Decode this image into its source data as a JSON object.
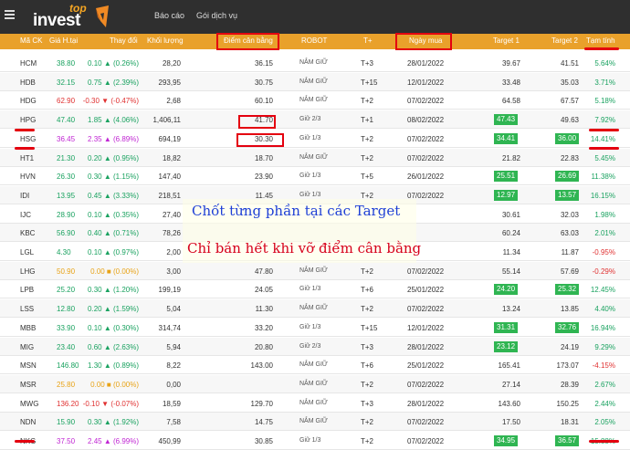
{
  "brand": {
    "logo_top": "top",
    "logo_invest": "invest",
    "colors": {
      "header_bg": "#2f2f2f",
      "table_header_bg": "#e9a12b",
      "up": "#1aa260",
      "down": "#e03131",
      "target_bg": "#2fb552",
      "annotation": "#e4000f"
    }
  },
  "nav": {
    "item1": "Báo cáo",
    "item2": "Gói dịch vụ"
  },
  "table": {
    "headers": [
      "Mã CK",
      "Giá H.tại",
      "Thay đổi",
      "Khối lượng",
      "Điểm cân bằng",
      "ROBOT",
      "T+",
      "Ngày mua",
      "Target 1",
      "Target 2",
      "Tạm tính"
    ],
    "rows": [
      {
        "code": "HCM",
        "price": "38.80",
        "chg": "0.10 ▲ (0.26%)",
        "dir": "up",
        "vol": "28,20",
        "bal": "36.15",
        "robot": "NẮM GIỮ",
        "t": "T+3",
        "date": "28/01/2022",
        "t1": "39.67",
        "t1hit": false,
        "t2": "41.51",
        "t2hit": false,
        "pct": "5.64%",
        "pdir": "up"
      },
      {
        "code": "HDB",
        "price": "32.15",
        "chg": "0.75 ▲ (2.39%)",
        "dir": "up",
        "vol": "293,95",
        "bal": "30.75",
        "robot": "NẮM GIỮ",
        "t": "T+15",
        "date": "12/01/2022",
        "t1": "33.48",
        "t1hit": false,
        "t2": "35.03",
        "t2hit": false,
        "pct": "3.71%",
        "pdir": "up"
      },
      {
        "code": "HDG",
        "price": "62.90",
        "chg": "-0.30 ▼ (-0.47%)",
        "dir": "dn",
        "vol": "2,68",
        "bal": "60.10",
        "robot": "NẮM GIỮ",
        "t": "T+2",
        "date": "07/02/2022",
        "t1": "64.58",
        "t1hit": false,
        "t2": "67.57",
        "t2hit": false,
        "pct": "5.18%",
        "pdir": "up"
      },
      {
        "code": "HPG",
        "price": "47.40",
        "chg": "1.85 ▲ (4.06%)",
        "dir": "up",
        "vol": "1,406,11",
        "bal": "41.70",
        "robot": "Giữ 2/3",
        "t": "T+1",
        "date": "08/02/2022",
        "t1": "47.43",
        "t1hit": true,
        "t2": "49.63",
        "t2hit": false,
        "pct": "7.92%",
        "pdir": "up"
      },
      {
        "code": "HSG",
        "price": "36.45",
        "chg": "2.35 ▲ (6.89%)",
        "dir": "ceil",
        "vol": "694,19",
        "bal": "30.30",
        "robot": "Giữ 1/3",
        "t": "T+2",
        "date": "07/02/2022",
        "t1": "34.41",
        "t1hit": true,
        "t2": "36.00",
        "t2hit": true,
        "pct": "14.41%",
        "pdir": "up"
      },
      {
        "code": "HT1",
        "price": "21.30",
        "chg": "0.20 ▲ (0.95%)",
        "dir": "up",
        "vol": "18,82",
        "bal": "18.70",
        "robot": "NẮM GIỮ",
        "t": "T+2",
        "date": "07/02/2022",
        "t1": "21.82",
        "t1hit": false,
        "t2": "22.83",
        "t2hit": false,
        "pct": "5.45%",
        "pdir": "up"
      },
      {
        "code": "HVN",
        "price": "26.30",
        "chg": "0.30 ▲ (1.15%)",
        "dir": "up",
        "vol": "147,40",
        "bal": "23.90",
        "robot": "Giữ 1/3",
        "t": "T+5",
        "date": "26/01/2022",
        "t1": "25.51",
        "t1hit": true,
        "t2": "26.69",
        "t2hit": true,
        "pct": "11.38%",
        "pdir": "up"
      },
      {
        "code": "IDI",
        "price": "13.95",
        "chg": "0.45 ▲ (3.33%)",
        "dir": "up",
        "vol": "218,51",
        "bal": "11.45",
        "robot": "Giữ 1/3",
        "t": "T+2",
        "date": "07/02/2022",
        "t1": "12.97",
        "t1hit": true,
        "t2": "13.57",
        "t2hit": true,
        "pct": "16.15%",
        "pdir": "up"
      },
      {
        "code": "IJC",
        "price": "28.90",
        "chg": "0.10 ▲ (0.35%)",
        "dir": "up",
        "vol": "27,40",
        "bal": "",
        "robot": "",
        "t": "",
        "date": "",
        "t1": "30.61",
        "t1hit": false,
        "t2": "32.03",
        "t2hit": false,
        "pct": "1.98%",
        "pdir": "up"
      },
      {
        "code": "KBC",
        "price": "56.90",
        "chg": "0.40 ▲ (0.71%)",
        "dir": "up",
        "vol": "78,26",
        "bal": "",
        "robot": "",
        "t": "",
        "date": "",
        "t1": "60.24",
        "t1hit": false,
        "t2": "63.03",
        "t2hit": false,
        "pct": "2.01%",
        "pdir": "up"
      },
      {
        "code": "LGL",
        "price": "4.30",
        "chg": "0.10 ▲ (0.97%)",
        "dir": "up",
        "vol": "2,00",
        "bal": "",
        "robot": "",
        "t": "",
        "date": "",
        "t1": "11.34",
        "t1hit": false,
        "t2": "11.87",
        "t2hit": false,
        "pct": "-0.95%",
        "pdir": "dn"
      },
      {
        "code": "LHG",
        "price": "50.90",
        "chg": "0.00 ■ (0.00%)",
        "dir": "ref",
        "vol": "3,00",
        "bal": "47.80",
        "robot": "NẮM GIỮ",
        "t": "T+2",
        "date": "07/02/2022",
        "t1": "55.14",
        "t1hit": false,
        "t2": "57.69",
        "t2hit": false,
        "pct": "-0.29%",
        "pdir": "dn"
      },
      {
        "code": "LPB",
        "price": "25.20",
        "chg": "0.30 ▲ (1.20%)",
        "dir": "up",
        "vol": "199,19",
        "bal": "24.05",
        "robot": "Giữ 1/3",
        "t": "T+6",
        "date": "25/01/2022",
        "t1": "24.20",
        "t1hit": true,
        "t2": "25.32",
        "t2hit": true,
        "pct": "12.45%",
        "pdir": "up"
      },
      {
        "code": "LSS",
        "price": "12.80",
        "chg": "0.20 ▲ (1.59%)",
        "dir": "up",
        "vol": "5,04",
        "bal": "11.30",
        "robot": "NẮM GIỮ",
        "t": "T+2",
        "date": "07/02/2022",
        "t1": "13.24",
        "t1hit": false,
        "t2": "13.85",
        "t2hit": false,
        "pct": "4.40%",
        "pdir": "up"
      },
      {
        "code": "MBB",
        "price": "33.90",
        "chg": "0.10 ▲ (0.30%)",
        "dir": "up",
        "vol": "314,74",
        "bal": "33.20",
        "robot": "Giữ 1/3",
        "t": "T+15",
        "date": "12/01/2022",
        "t1": "31.31",
        "t1hit": true,
        "t2": "32.76",
        "t2hit": true,
        "pct": "16.94%",
        "pdir": "up"
      },
      {
        "code": "MIG",
        "price": "23.40",
        "chg": "0.60 ▲ (2.63%)",
        "dir": "up",
        "vol": "5,94",
        "bal": "20.80",
        "robot": "Giữ 2/3",
        "t": "T+3",
        "date": "28/01/2022",
        "t1": "23.12",
        "t1hit": true,
        "t2": "24.19",
        "t2hit": false,
        "pct": "9.29%",
        "pdir": "up"
      },
      {
        "code": "MSN",
        "price": "146.80",
        "chg": "1.30 ▲ (0.89%)",
        "dir": "up",
        "vol": "8,22",
        "bal": "143.00",
        "robot": "NẮM GIỮ",
        "t": "T+6",
        "date": "25/01/2022",
        "t1": "165.41",
        "t1hit": false,
        "t2": "173.07",
        "t2hit": false,
        "pct": "-4.15%",
        "pdir": "dn"
      },
      {
        "code": "MSR",
        "price": "25.80",
        "chg": "0.00 ■ (0.00%)",
        "dir": "ref",
        "vol": "0,00",
        "bal": "",
        "robot": "NẮM GIỮ",
        "t": "T+2",
        "date": "07/02/2022",
        "t1": "27.14",
        "t1hit": false,
        "t2": "28.39",
        "t2hit": false,
        "pct": "2.67%",
        "pdir": "up"
      },
      {
        "code": "MWG",
        "price": "136.20",
        "chg": "-0.10 ▼ (-0.07%)",
        "dir": "dn",
        "vol": "18,59",
        "bal": "129.70",
        "robot": "NẮM GIỮ",
        "t": "T+3",
        "date": "28/01/2022",
        "t1": "143.60",
        "t1hit": false,
        "t2": "150.25",
        "t2hit": false,
        "pct": "2.44%",
        "pdir": "up"
      },
      {
        "code": "NDN",
        "price": "15.90",
        "chg": "0.30 ▲ (1.92%)",
        "dir": "up",
        "vol": "7,58",
        "bal": "14.75",
        "robot": "NẮM GIỮ",
        "t": "T+2",
        "date": "07/02/2022",
        "t1": "17.50",
        "t1hit": false,
        "t2": "18.31",
        "t2hit": false,
        "pct": "2.05%",
        "pdir": "up"
      },
      {
        "code": "NKG",
        "price": "37.50",
        "chg": "2.45 ▲ (6.99%)",
        "dir": "ceil",
        "vol": "450,99",
        "bal": "30.85",
        "robot": "Giữ 1/3",
        "t": "T+2",
        "date": "07/02/2022",
        "t1": "34.95",
        "t1hit": true,
        "t2": "36.57",
        "t2hit": true,
        "pct": "15.88%",
        "pdir": "up"
      }
    ]
  },
  "annotations": {
    "line1": "Chốt từng phần tại các Target",
    "line2": "Chỉ bán hết khi vỡ điểm cân bằng"
  }
}
